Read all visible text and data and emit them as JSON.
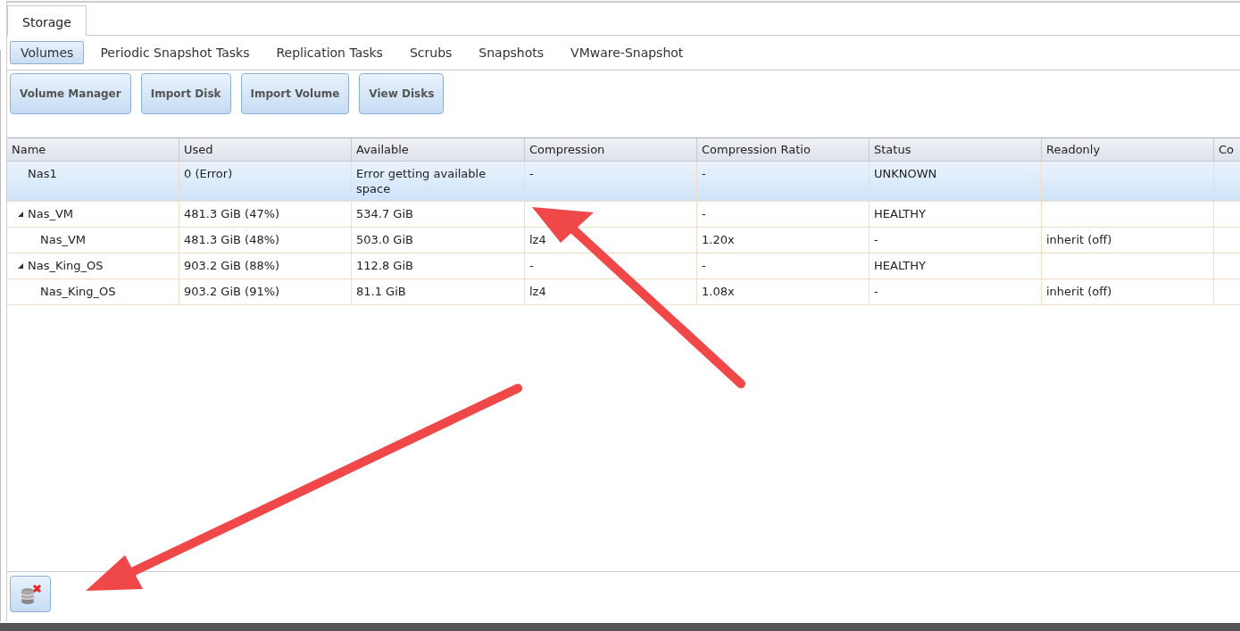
{
  "tabs": [
    {
      "label": "Storage",
      "selected": true
    }
  ],
  "subtabs": [
    {
      "label": "Volumes",
      "selected": true
    },
    {
      "label": "Periodic Snapshot Tasks",
      "selected": false
    },
    {
      "label": "Replication Tasks",
      "selected": false
    },
    {
      "label": "Scrubs",
      "selected": false
    },
    {
      "label": "Snapshots",
      "selected": false
    },
    {
      "label": "VMware-Snapshot",
      "selected": false
    }
  ],
  "toolbar": [
    "Volume Manager",
    "Import Disk",
    "Import Volume",
    "View Disks"
  ],
  "table": {
    "columns": [
      "Name",
      "Used",
      "Available",
      "Compression",
      "Compression Ratio",
      "Status",
      "Readonly",
      "Co"
    ],
    "rows": [
      {
        "name": "Nas1",
        "used": "0 (Error)",
        "available": "Error getting available space",
        "compression": "-",
        "compression_ratio": "-",
        "status": "UNKNOWN",
        "selected": true
      },
      {
        "name": "Nas_VM",
        "used": "481.3 GiB (47%)",
        "available": "534.7 GiB",
        "compression_ratio": "-",
        "status": "HEALTHY",
        "selected": false,
        "expanded": true,
        "children": [
          {
            "name": "Nas_VM",
            "used": "481.3 GiB (48%)",
            "available": "503.0 GiB",
            "compression": "lz4",
            "compression_ratio": "1.20x",
            "status": "-",
            "readonly": "inherit (off)",
            "selected": false
          }
        ]
      },
      {
        "name": "Nas_King_OS",
        "used": "903.2 GiB (88%)",
        "available": "112.8 GiB",
        "compression": "-",
        "compression_ratio": "-",
        "status": "HEALTHY",
        "selected": false,
        "expanded": true,
        "children": [
          {
            "name": "Nas_King_OS",
            "used": "903.2 GiB (91%)",
            "available": "81.1 GiB",
            "compression": "lz4",
            "compression_ratio": "1.08x",
            "status": "-",
            "readonly": "inherit (off)",
            "selected": false
          }
        ]
      }
    ]
  }
}
